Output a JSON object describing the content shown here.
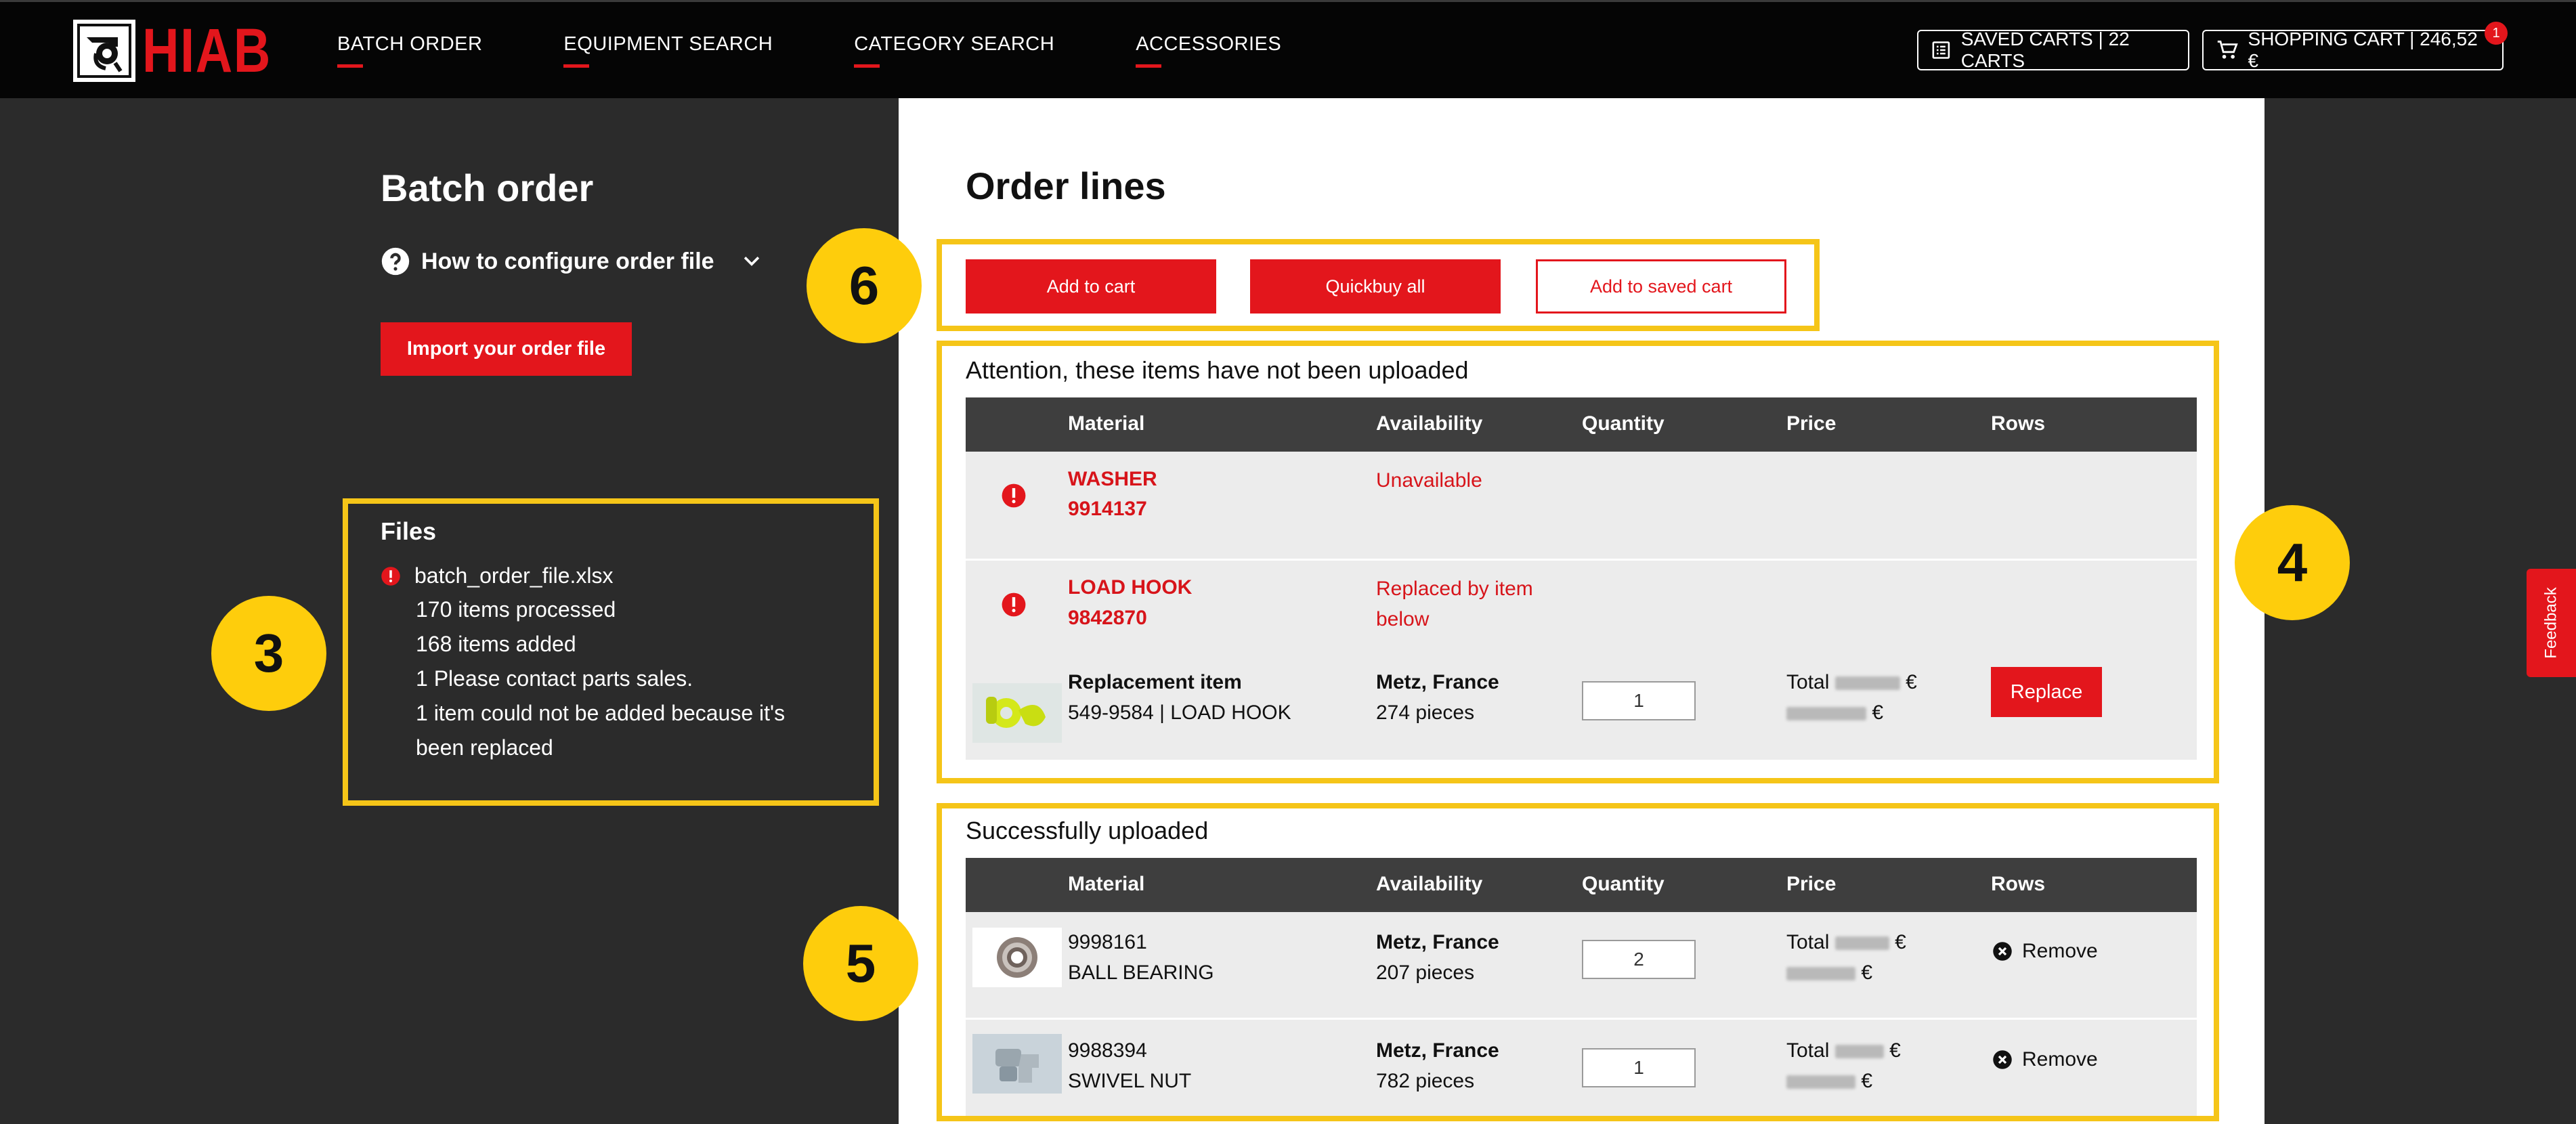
{
  "header": {
    "brand": "HIAB",
    "nav": [
      "BATCH ORDER",
      "EQUIPMENT SEARCH",
      "CATEGORY SEARCH",
      "ACCESSORIES"
    ],
    "saved_carts": "SAVED CARTS | 22 CARTS",
    "shopping_cart": "SHOPPING CART | 246,52 €",
    "cart_count": "1"
  },
  "left": {
    "title": "Batch order",
    "howto": "How to configure order file",
    "import_button": "Import your order file",
    "files": {
      "title": "Files",
      "filename": "batch_order_file.xlsx",
      "lines": [
        "170 items processed",
        "168 items added",
        "1 Please contact parts sales.",
        "1 item could not be added because it's",
        "been replaced"
      ]
    }
  },
  "callouts": [
    "3",
    "4",
    "5",
    "6"
  ],
  "main": {
    "title": "Order lines",
    "buttons": {
      "add_to_cart": "Add to cart",
      "quickbuy": "Quickbuy all",
      "add_to_saved": "Add to saved cart"
    },
    "columns": [
      "Material",
      "Availability",
      "Quantity",
      "Price",
      "Rows"
    ],
    "not_uploaded": {
      "title": "Attention, these items have not been uploaded",
      "items": [
        {
          "name": "WASHER",
          "code": "9914137",
          "availability": "Unavailable"
        },
        {
          "name": "LOAD HOOK",
          "code": "9842870",
          "availability_1": "Replaced by item",
          "availability_2": "below"
        }
      ],
      "replacement": {
        "label": "Replacement item",
        "detail": "549-9584 | LOAD HOOK",
        "location": "Metz, France",
        "stock": "274 pieces",
        "quantity": "1",
        "total_label": "Total",
        "currency": "€",
        "action": "Replace"
      }
    },
    "uploaded": {
      "title": "Successfully uploaded",
      "items": [
        {
          "code": "9998161",
          "name": "BALL BEARING",
          "location": "Metz, France",
          "stock": "207 pieces",
          "quantity": "2",
          "total_label": "Total",
          "currency": "€",
          "action": "Remove"
        },
        {
          "code": "9988394",
          "name": "SWIVEL NUT",
          "location": "Metz, France",
          "stock": "782 pieces",
          "quantity": "1",
          "total_label": "Total",
          "currency": "€",
          "action": "Remove"
        }
      ]
    }
  },
  "feedback": "Feedback",
  "colors": {
    "brand_red": "#e3161c",
    "highlight": "#f5c518",
    "callout": "#fecd0c",
    "dark_bg": "#2b2b2b"
  }
}
